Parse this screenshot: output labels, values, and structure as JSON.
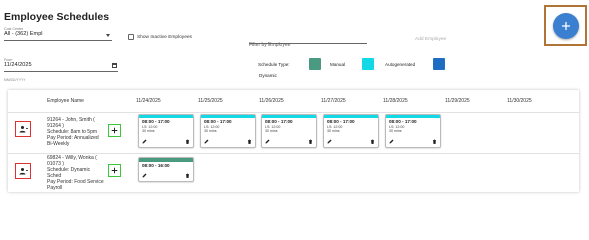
{
  "page": {
    "title": "Employee Schedules"
  },
  "filters": {
    "cost_center": {
      "label": "Cost Center",
      "value": "All - (362) Empl"
    },
    "show_inactive": {
      "label": "Show Inactive Employees",
      "checked": false
    },
    "employee_filter": {
      "placeholder": "Filter by Employee"
    },
    "add_employee": {
      "label": "Add Employee"
    },
    "from": {
      "label": "From",
      "value": "11/24/2025",
      "hint": "MM/DD/YYYY"
    }
  },
  "fab": {
    "icon": "plus-icon",
    "color": "#3a7fd0"
  },
  "legend": {
    "title": "Schedule Type:",
    "items": [
      {
        "label": "Manual",
        "color": "#4a9a82"
      },
      {
        "label": "Autogenerated",
        "color": "#13d8e6"
      },
      {
        "label": "Dynamic",
        "color": "#1f6cc4"
      }
    ]
  },
  "grid": {
    "headers": [
      "Employee Name",
      "11/24/2025",
      "11/25/2025",
      "11/26/2025",
      "11/27/2025",
      "11/28/2025",
      "11/29/2025",
      "11/30/2025"
    ],
    "rows": [
      {
        "employee_lines": [
          "91264 - John, Smith (",
          "91264 )",
          "Schedule: 8am to 5pm",
          "Pay Period: Annualized",
          "Bi-Weekly"
        ],
        "shifts": [
          {
            "time": "08:00 - 17:00",
            "ls": "LS: 12:00",
            "break": "30 mins",
            "type": "autogenerated"
          },
          {
            "time": "08:00 - 17:00",
            "ls": "LS: 12:00",
            "break": "30 mins",
            "type": "autogenerated"
          },
          {
            "time": "08:00 - 17:00",
            "ls": "LS: 12:00",
            "break": "30 mins",
            "type": "autogenerated"
          },
          {
            "time": "08:00 - 17:00",
            "ls": "LS: 12:00",
            "break": "30 mins",
            "type": "autogenerated"
          },
          {
            "time": "08:00 - 17:00",
            "ls": "LS: 12:00",
            "break": "30 mins",
            "type": "autogenerated"
          }
        ]
      },
      {
        "employee_lines": [
          "69824 - Willy, Wonka (",
          "01073 )",
          "Schedule: Dynamic",
          "Sched",
          "Pay Period: Food Service",
          "Payroll"
        ],
        "shifts": [
          {
            "time": "08:00 - 16:00",
            "ls": "",
            "break": "",
            "type": "manual"
          }
        ]
      }
    ]
  }
}
